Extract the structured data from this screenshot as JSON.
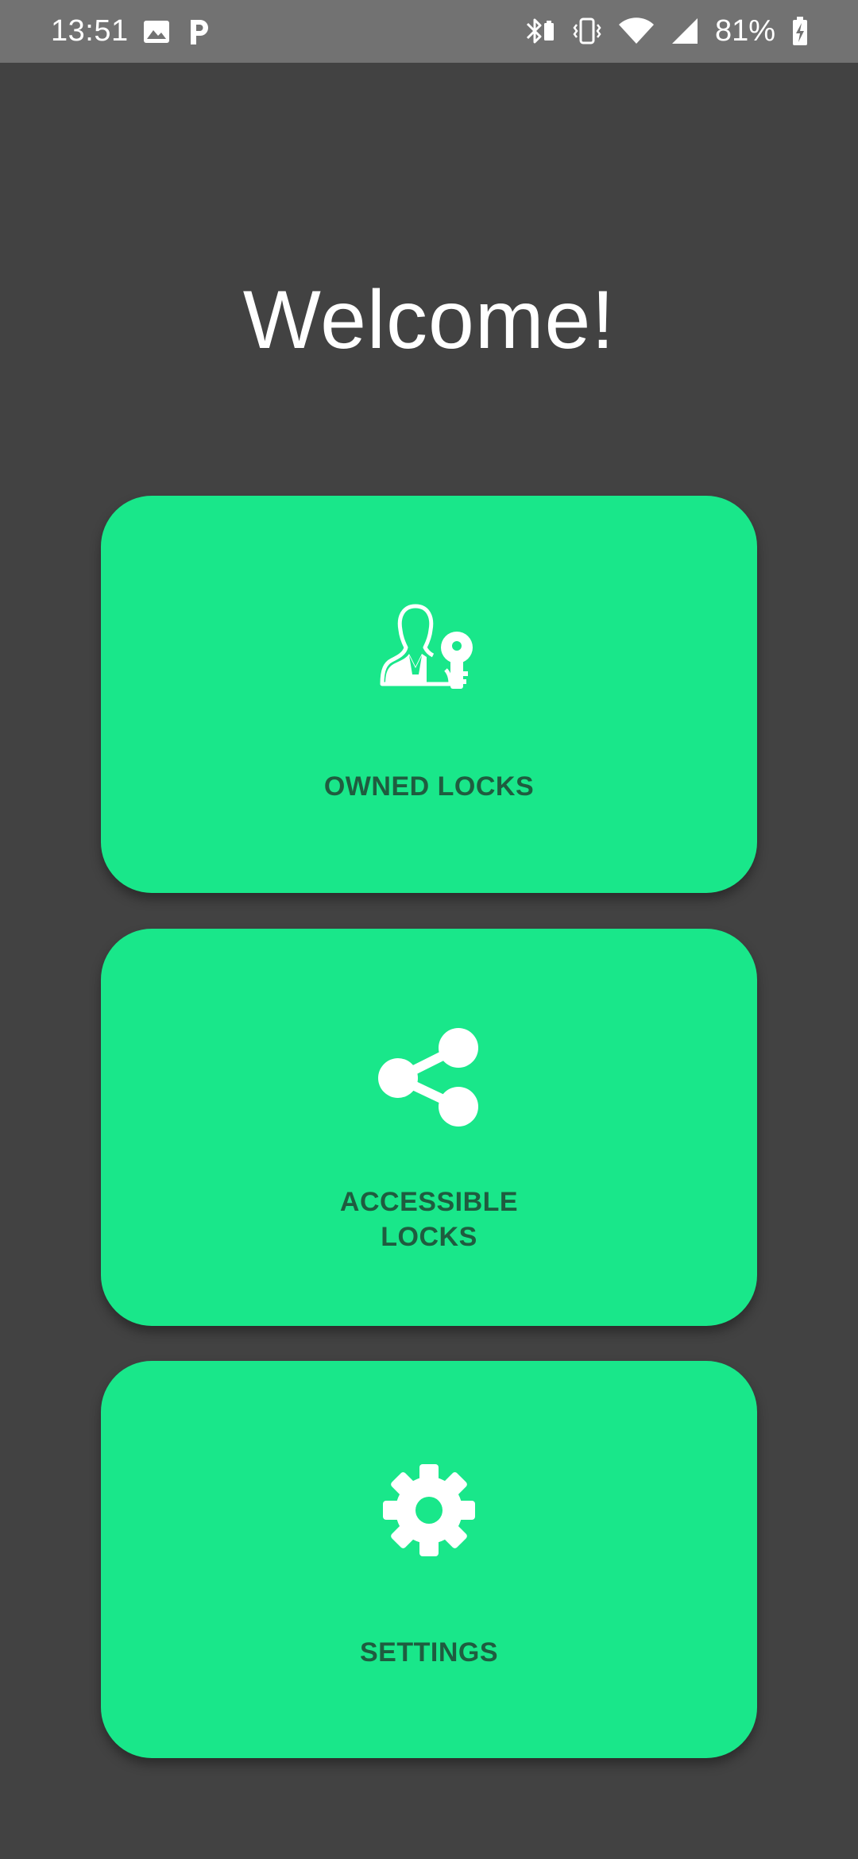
{
  "status_bar": {
    "time": "13:51",
    "battery_percent": "81%",
    "left_icons": [
      "image-icon",
      "parking-p-icon"
    ],
    "right_icons": [
      "bluetooth-battery-icon",
      "vibrate-icon",
      "wifi-icon",
      "cell-signal-icon",
      "battery-charging-icon"
    ]
  },
  "title": "Welcome!",
  "cards": [
    {
      "label": "OWNED LOCKS",
      "icon": "person-key-icon"
    },
    {
      "label": "ACCESSIBLE\nLOCKS",
      "icon": "share-icon"
    },
    {
      "label": "SETTINGS",
      "icon": "gear-icon"
    }
  ],
  "colors": {
    "background": "#424242",
    "status_bar": "#727272",
    "card": "#19e78a",
    "card_text": "#1f5c3f",
    "icon": "#ffffff"
  }
}
